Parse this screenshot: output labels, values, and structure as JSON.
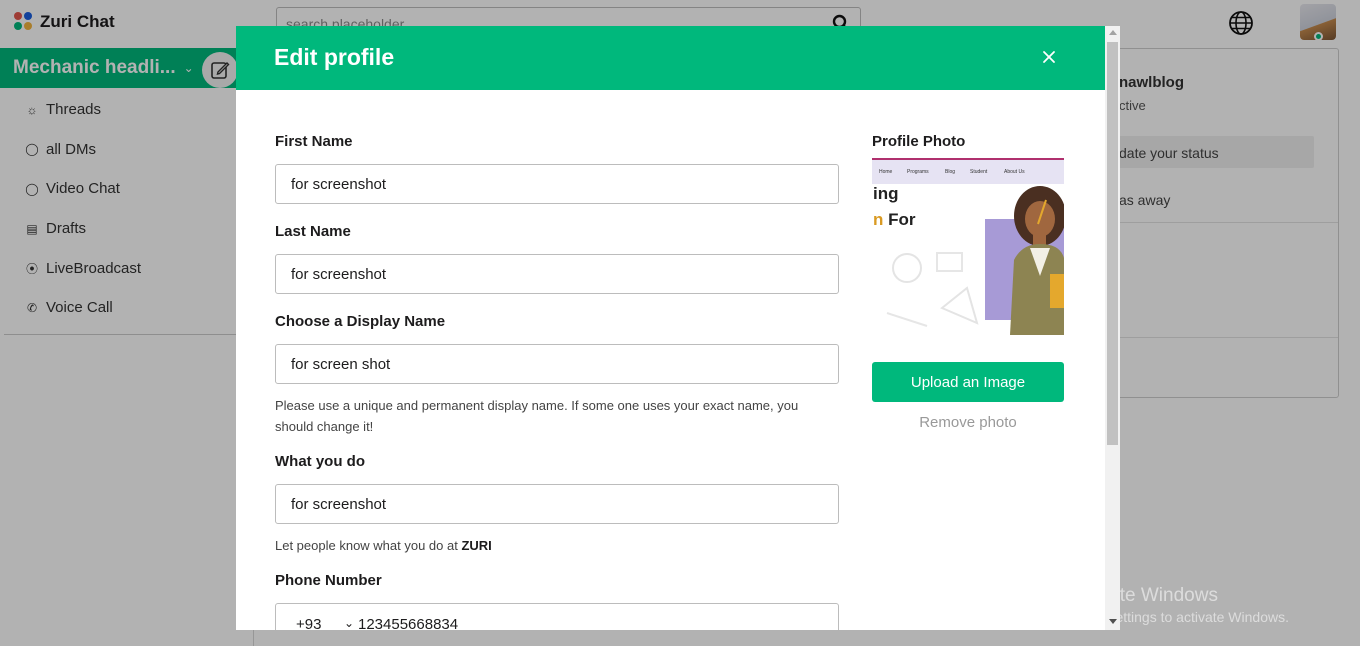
{
  "app": {
    "name": "Zuri Chat",
    "search_placeholder": "search placeholder",
    "brand_colors": [
      "#e2574c",
      "#1a5fe0",
      "#00b87c",
      "#f3b33d"
    ]
  },
  "sidebar": {
    "workspace_name": "Mechanic headli...",
    "items": [
      {
        "label": "Threads",
        "icon": "threads-icon"
      },
      {
        "label": "all DMs",
        "icon": "dm-icon"
      },
      {
        "label": "Video Chat",
        "icon": "video-chat-icon"
      },
      {
        "label": "Drafts",
        "icon": "drafts-icon"
      },
      {
        "label": "LiveBroadcast",
        "icon": "broadcast-icon"
      },
      {
        "label": "Voice Call",
        "icon": "phone-icon"
      }
    ]
  },
  "profile_panel": {
    "username": "nawlblog",
    "status": "ctive",
    "update_status": "date your status",
    "set_away": "as away"
  },
  "modal": {
    "title": "Edit profile",
    "first_name": {
      "label": "First Name",
      "value": "for screenshot"
    },
    "last_name": {
      "label": "Last Name",
      "value": "for screenshot"
    },
    "display_name": {
      "label": "Choose a Display Name",
      "value": "for screen shot",
      "help": "Please use a unique and permanent display name. If some one uses your exact name, you should change it!"
    },
    "what_you_do": {
      "label": "What you do",
      "value": "for screenshot",
      "help_prefix": "Let people know what you do at ",
      "help_org": "ZURI"
    },
    "phone": {
      "label": "Phone Number",
      "code": "+93",
      "number": "123455668834"
    },
    "photo": {
      "label": "Profile Photo",
      "nav": [
        "Home",
        "Programs",
        "Blog",
        "Student",
        "About Us"
      ],
      "headline_1": "ing",
      "headline_2_a": "n",
      "headline_2_b": "For",
      "upload_label": "Upload an Image",
      "remove_label": "Remove photo"
    }
  },
  "watermark": {
    "line1": "Activate Windows",
    "line2": "Go to Settings to activate Windows."
  },
  "theme": {
    "accent": "#00b87c"
  }
}
